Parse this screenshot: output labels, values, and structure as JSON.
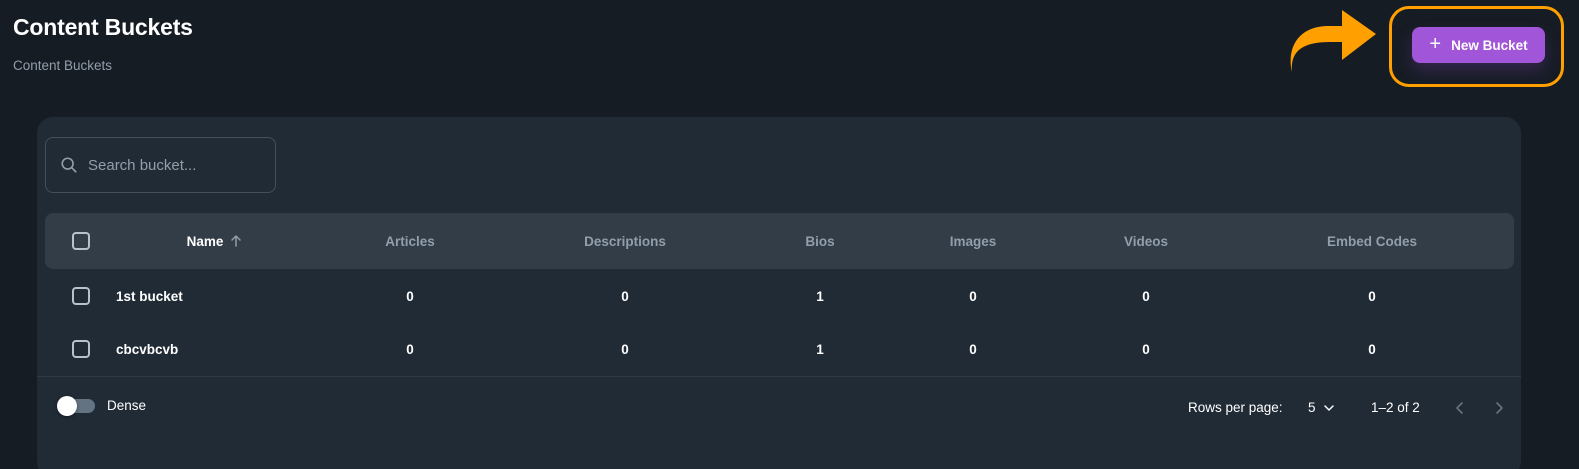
{
  "header": {
    "title": "Content Buckets",
    "breadcrumb": "Content Buckets",
    "new_button_label": "New Bucket"
  },
  "search": {
    "placeholder": "Search bucket...",
    "value": ""
  },
  "table": {
    "columns": [
      "Name",
      "Articles",
      "Descriptions",
      "Bios",
      "Images",
      "Videos",
      "Embed Codes"
    ],
    "sort_column": "Name",
    "sort_direction": "ascending",
    "rows": [
      {
        "name": "1st bucket",
        "articles": "0",
        "descriptions": "0",
        "bios": "1",
        "images": "0",
        "videos": "0",
        "embed_codes": "0"
      },
      {
        "name": "cbcvbcvb",
        "articles": "0",
        "descriptions": "0",
        "bios": "1",
        "images": "0",
        "videos": "0",
        "embed_codes": "0"
      }
    ]
  },
  "footer": {
    "dense_label": "Dense",
    "dense_enabled": false,
    "rows_per_page_label": "Rows per page:",
    "rows_per_page_value": "5",
    "page_range": "1–2 of 2"
  },
  "colors": {
    "background": "#161c24",
    "card": "#212b36",
    "accent": "#a155d8",
    "annotation": "#ffa000"
  }
}
